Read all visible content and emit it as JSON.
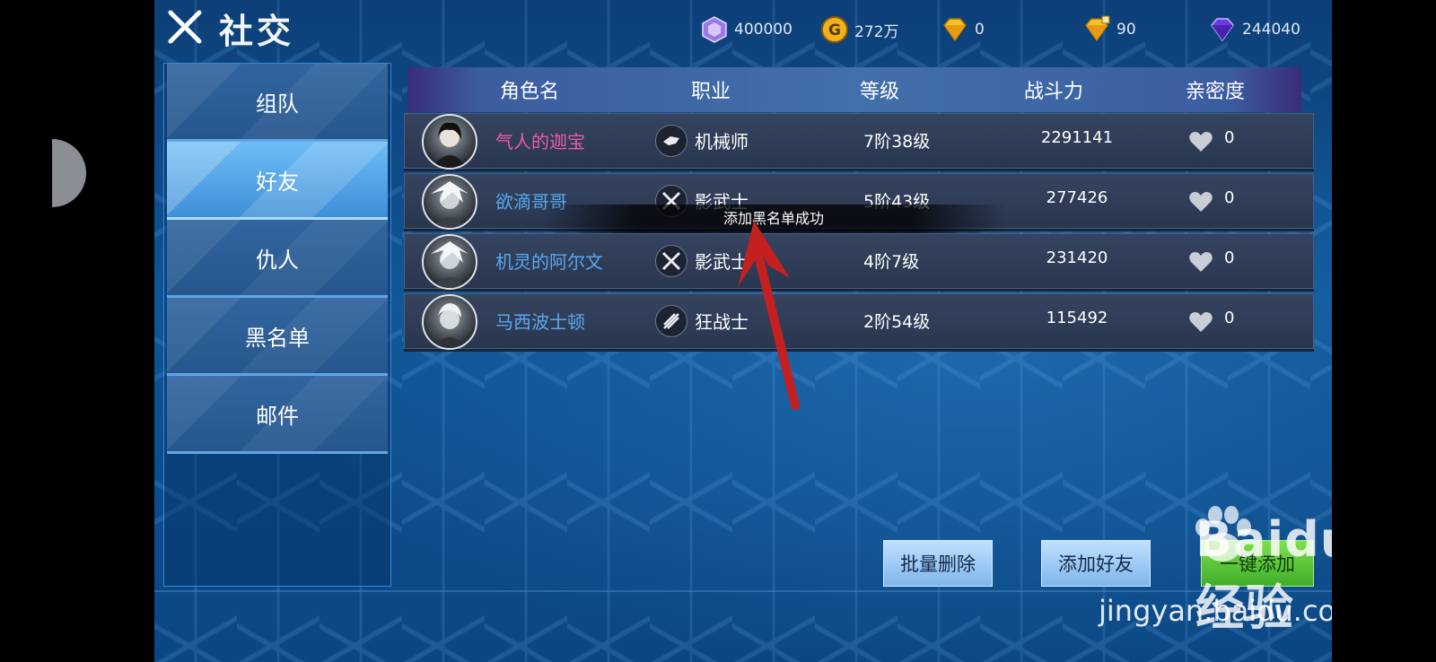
{
  "header": {
    "title": "社交",
    "currencies": [
      {
        "icon": "purple-crystal-icon",
        "value": "400000"
      },
      {
        "icon": "gold-coin-icon",
        "value": "272万"
      },
      {
        "icon": "gold-diamond-icon",
        "value": "0"
      },
      {
        "icon": "bound-gold-diamond-icon",
        "value": "90"
      },
      {
        "icon": "purple-diamond-icon",
        "value": "244040"
      }
    ]
  },
  "sidebar": {
    "items": [
      {
        "label": "组队"
      },
      {
        "label": "好友"
      },
      {
        "label": "仇人"
      },
      {
        "label": "黑名单"
      },
      {
        "label": "邮件"
      }
    ],
    "active_index": 1
  },
  "table": {
    "columns": [
      "角色名",
      "职业",
      "等级",
      "战斗力",
      "亲密度"
    ],
    "rows": [
      {
        "name": "气人的迦宝",
        "name_color": "#f05aa8",
        "job": "机械师",
        "level": "7阶38级",
        "power": "2291141",
        "intimacy": "0"
      },
      {
        "name": "欲滴哥哥",
        "name_color": "#5aa8f0",
        "job": "影武士",
        "level": "5阶43级",
        "power": "277426",
        "intimacy": "0"
      },
      {
        "name": "机灵的阿尔文",
        "name_color": "#5aa8f0",
        "job": "影武士",
        "level": "4阶7级",
        "power": "231420",
        "intimacy": "0"
      },
      {
        "name": "马西波士顿",
        "name_color": "#5aa8f0",
        "job": "狂战士",
        "level": "2阶54级",
        "power": "115492",
        "intimacy": "0"
      }
    ]
  },
  "toast": "添加黑名单成功",
  "buttons": {
    "batch_delete": "批量删除",
    "add_friend": "添加好友",
    "one_click_add": "一键添加"
  },
  "watermark": {
    "brand": "Baidu经验",
    "url": "jingyan.baidu.com"
  },
  "colors": {
    "accent_blue": "#3c86d4",
    "toast_bg": "#000000",
    "arrow": "#c42020"
  }
}
